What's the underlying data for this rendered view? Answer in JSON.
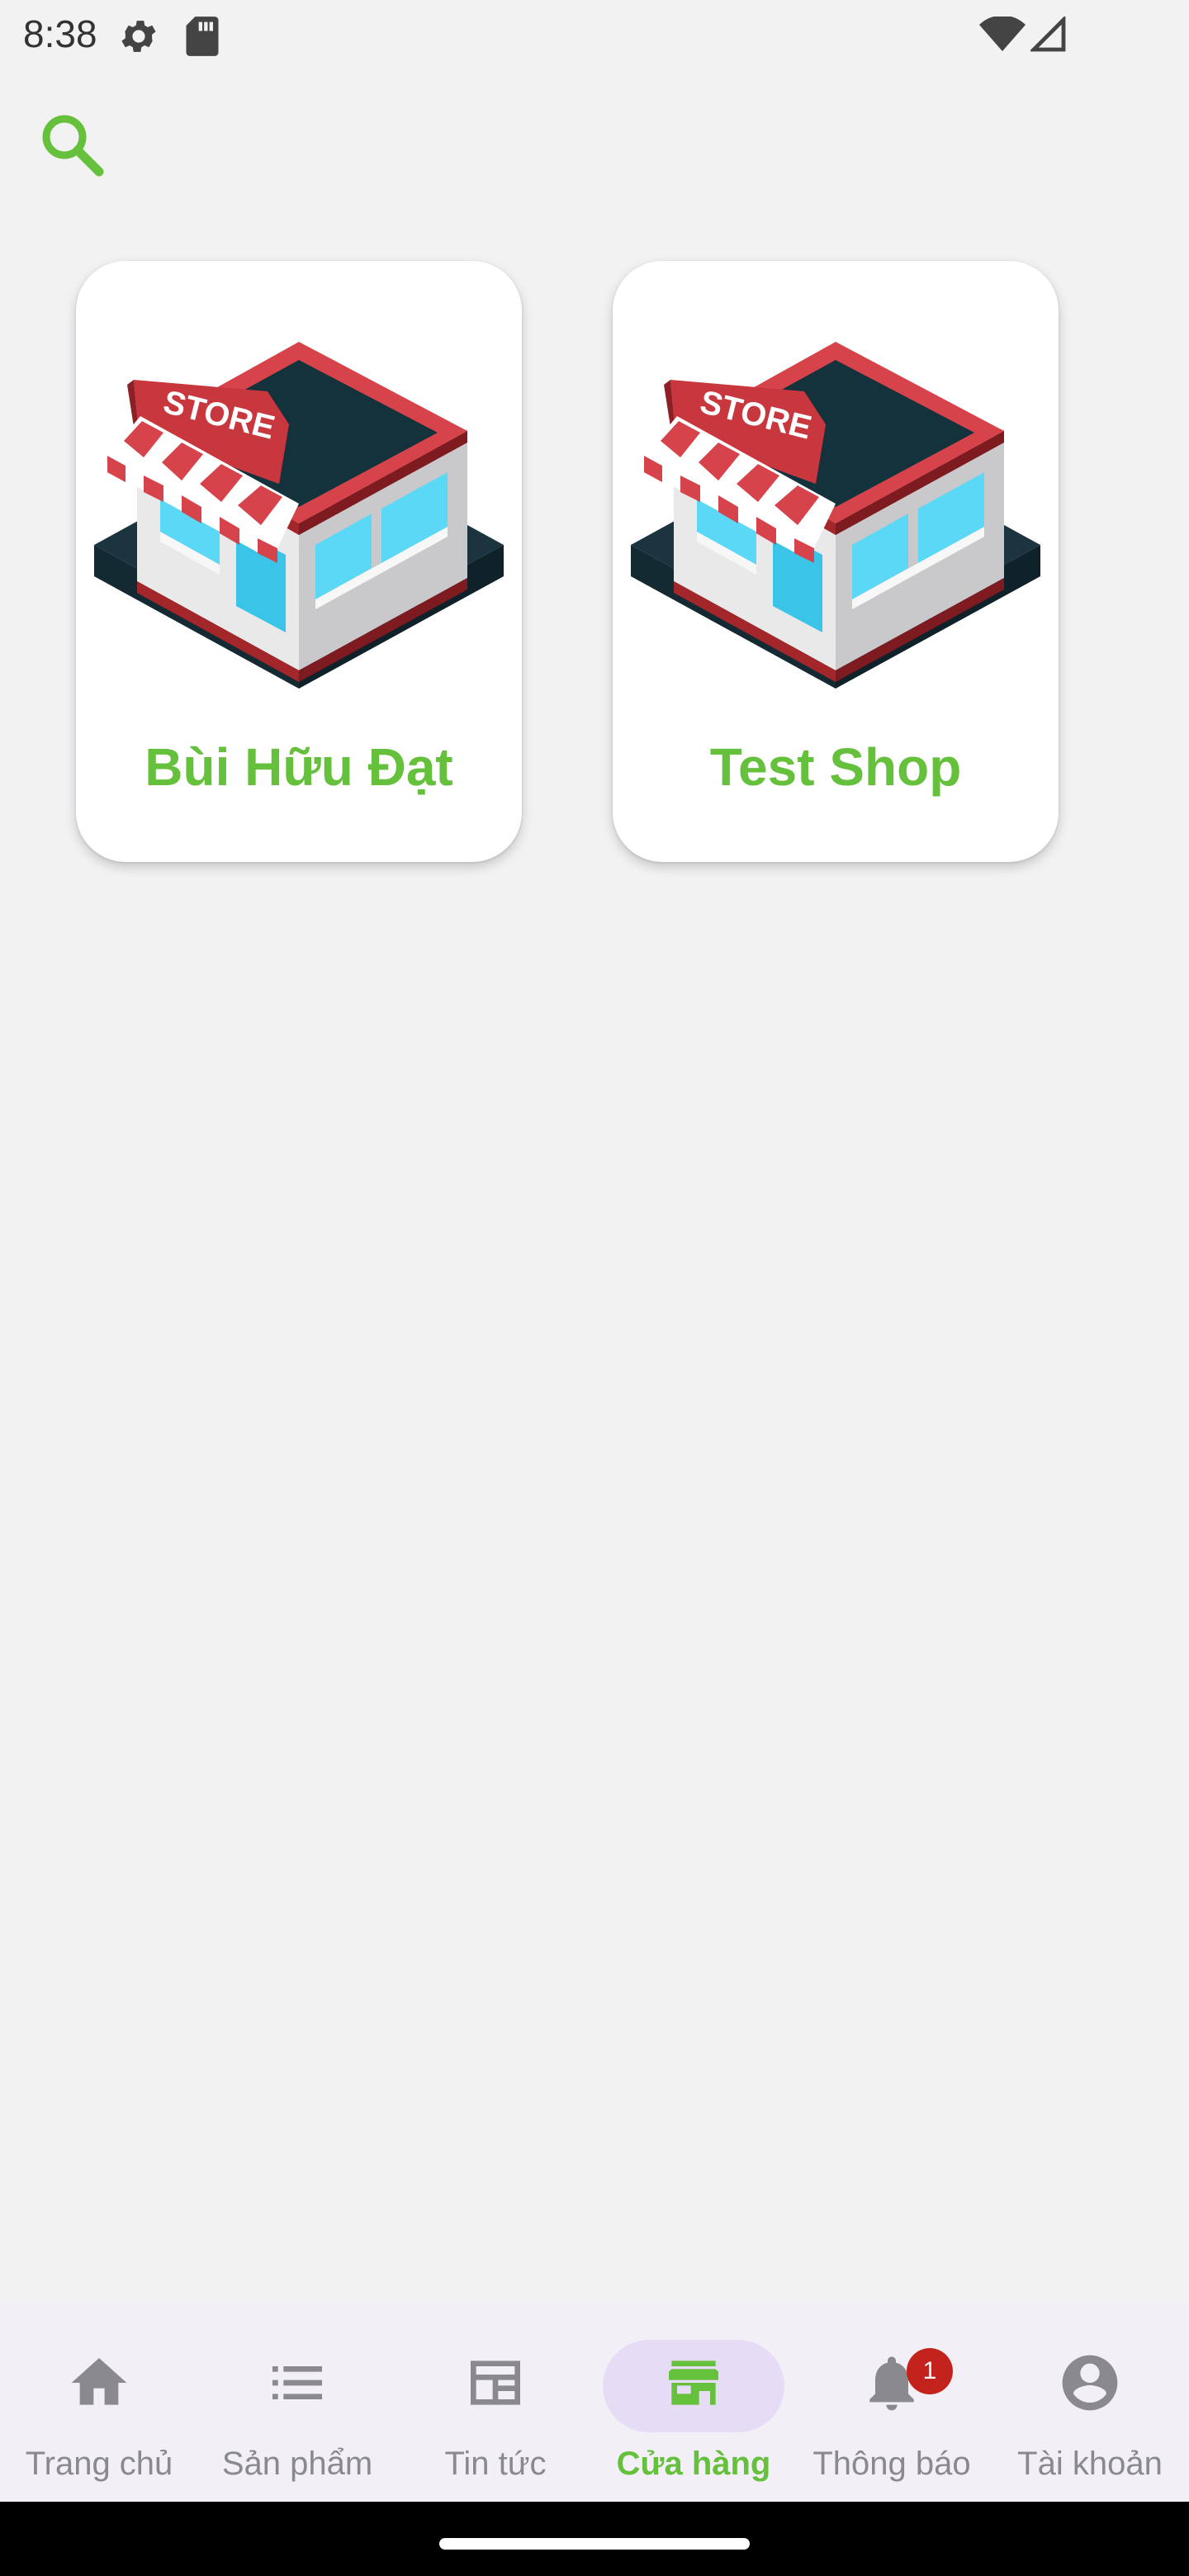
{
  "status_bar": {
    "time": "8:38",
    "icons": [
      "gear-icon",
      "sd-card-icon",
      "wifi-icon",
      "signal-icon"
    ]
  },
  "search": {
    "icon": "search-icon",
    "color": "#65c03c"
  },
  "stores": [
    {
      "name": "Bùi Hữu Đạt",
      "icon": "store-building-icon"
    },
    {
      "name": "Test Shop",
      "icon": "store-building-icon"
    }
  ],
  "bottom_nav": {
    "items": [
      {
        "label": "Trang chủ",
        "icon": "home-icon"
      },
      {
        "label": "Sản phẩm",
        "icon": "list-icon"
      },
      {
        "label": "Tin tức",
        "icon": "newspaper-icon"
      },
      {
        "label": "Cửa hàng",
        "icon": "storefront-icon",
        "active": true
      },
      {
        "label": "Thông báo",
        "icon": "bell-icon",
        "badge": "1"
      },
      {
        "label": "Tài khoản",
        "icon": "account-icon"
      }
    ]
  },
  "colors": {
    "accent": "#65c03c",
    "background": "#f2f2f3",
    "nav_background": "#f2eff6",
    "active_pill": "#e6dcf5",
    "badge": "#c4221c",
    "inactive": "#8a8a8e"
  }
}
